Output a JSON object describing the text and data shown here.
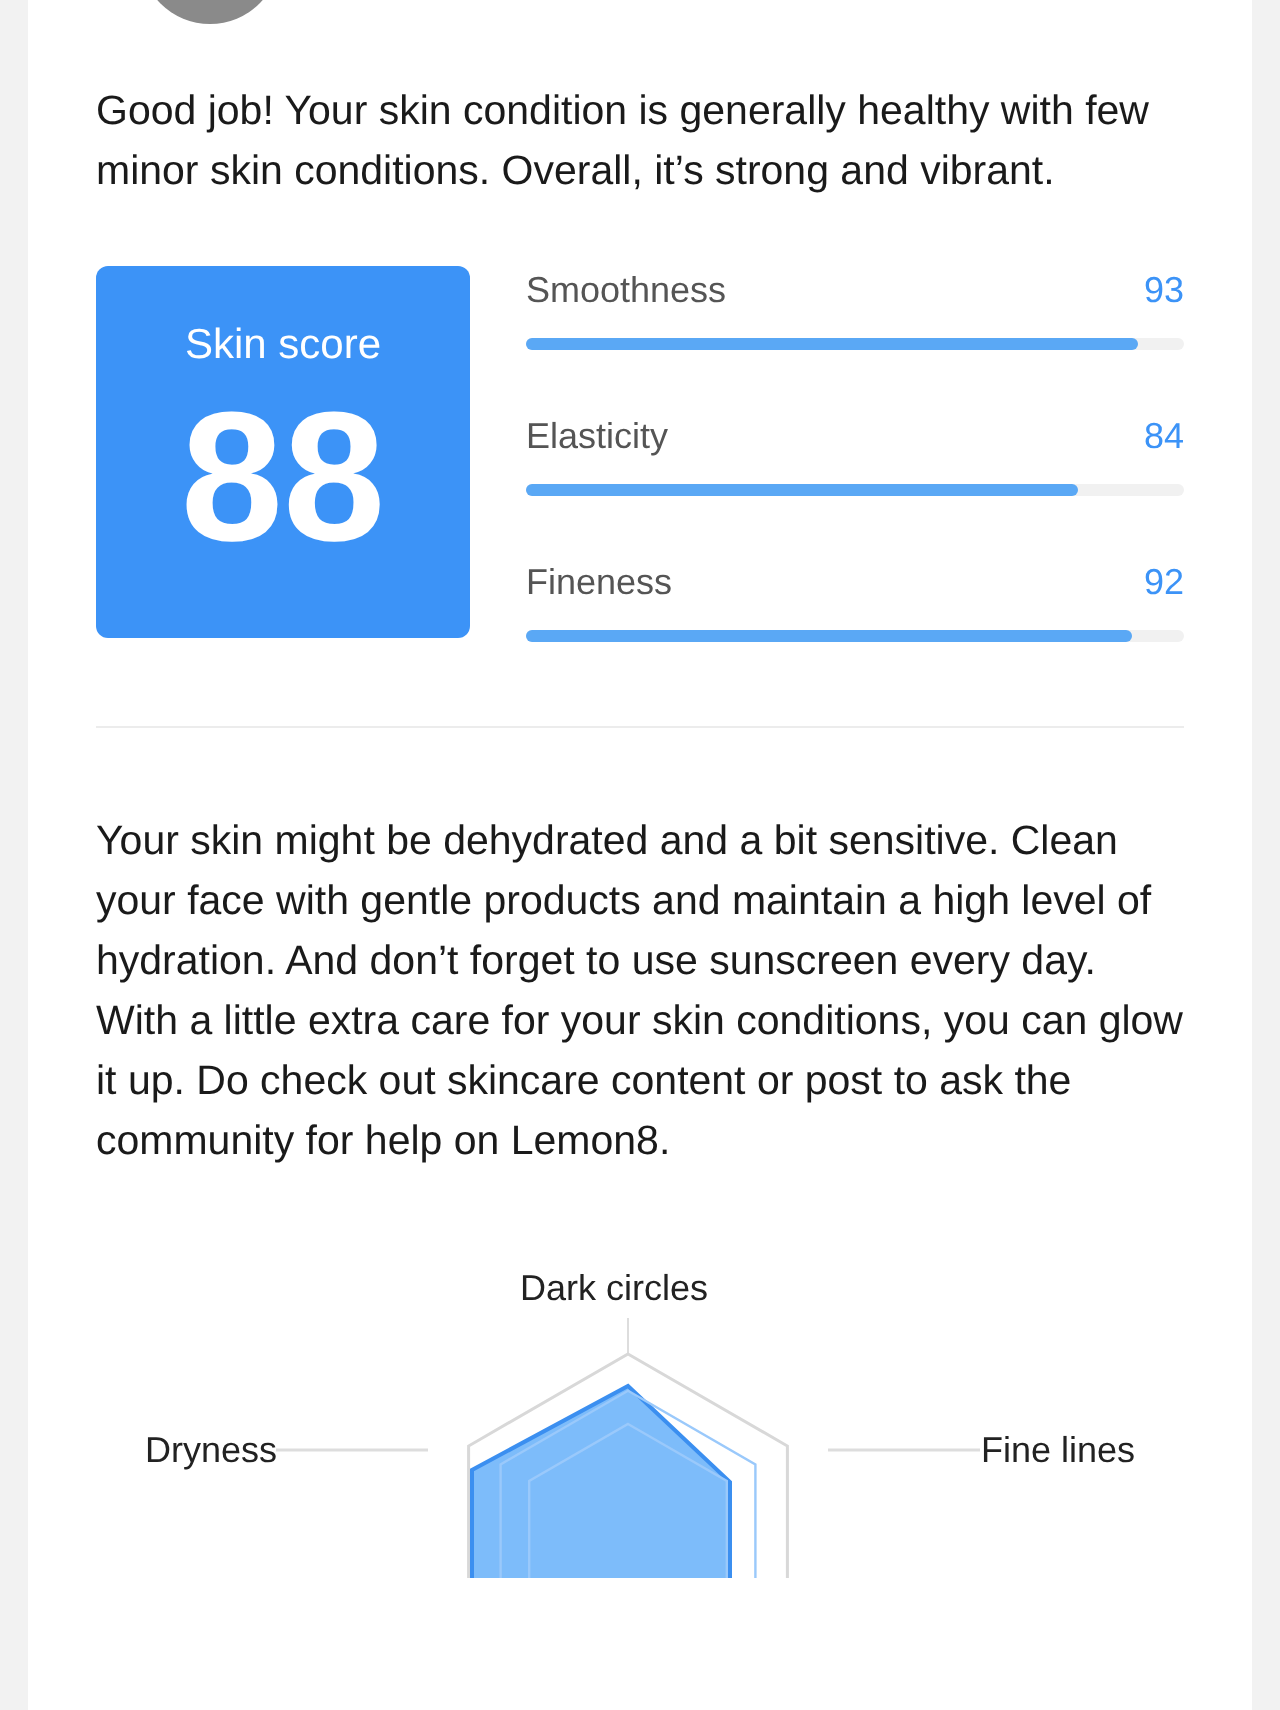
{
  "summary": "Good job! Your skin condition is generally healthy with few minor skin conditions. Overall, it’s strong and vibrant.",
  "score": {
    "label": "Skin score",
    "value": "88"
  },
  "metrics": [
    {
      "name": "Smoothness",
      "value": "93",
      "level": 0.93
    },
    {
      "name": "Elasticity",
      "value": "84",
      "level": 0.84
    },
    {
      "name": "Fineness",
      "value": "92",
      "level": 0.92
    }
  ],
  "advice": "Your skin might be dehydrated and a bit sensitive. Clean your face with gentle products and maintain a high level of hydration. And don’t forget to use sunscreen every day. With a little extra care for your skin conditions, you can glow it up. Do check out skincare content or post to ask the community for help on Lemon8.",
  "radar": {
    "labels": {
      "top": "Dark circles",
      "left": "Dryness",
      "right": "Fine lines"
    }
  }
}
